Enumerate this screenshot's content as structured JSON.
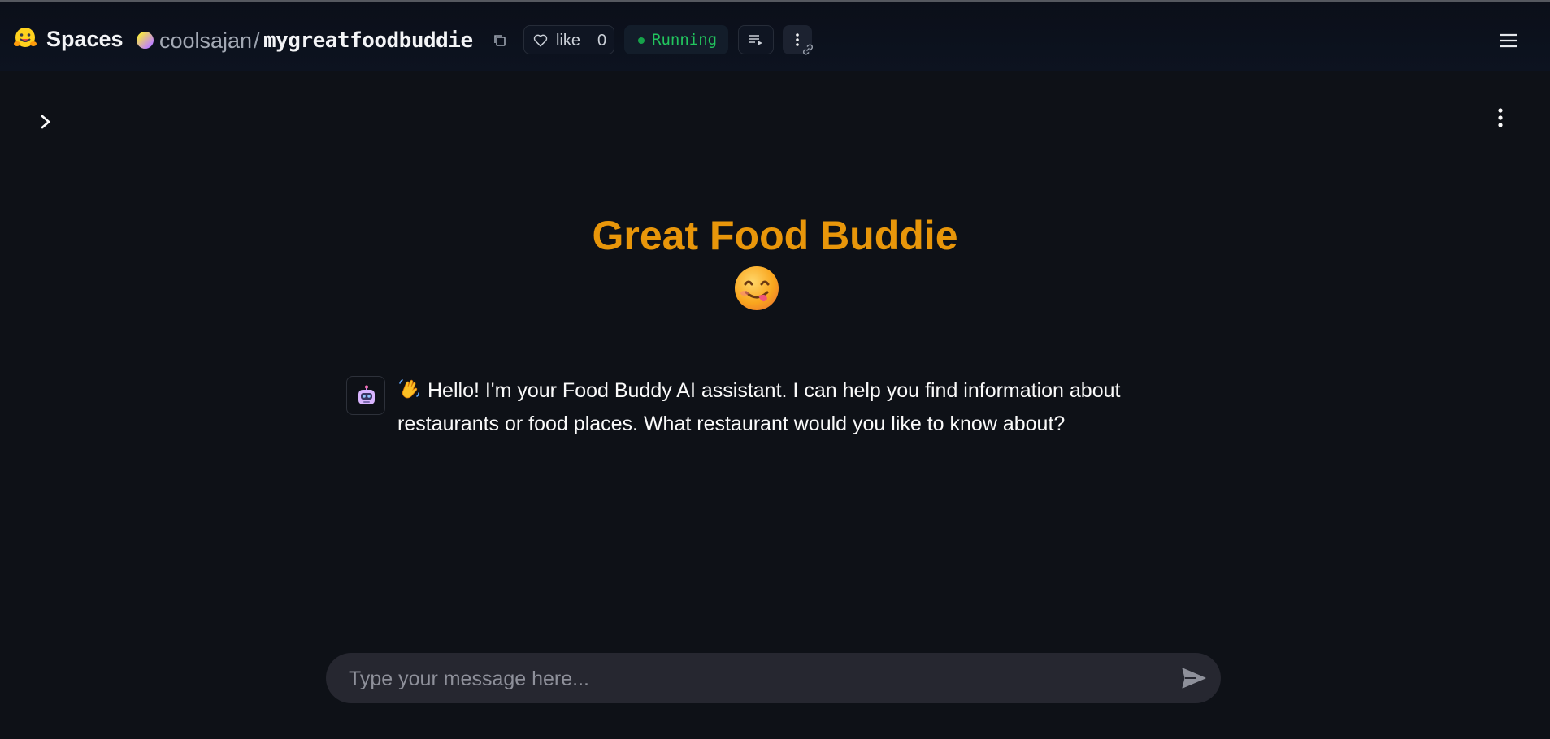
{
  "header": {
    "spaces_label": "Spaces",
    "owner": "coolsajan",
    "separator": "/",
    "repo": "mygreatfoodbuddie",
    "like_label": "like",
    "like_count": "0",
    "status": "Running",
    "status_color": "#22c55e"
  },
  "app": {
    "title": "Great Food Buddie",
    "title_color": "#e8960a",
    "title_emoji": "face-savoring-food",
    "messages": [
      {
        "role": "assistant",
        "avatar": "robot-icon",
        "prefix_emoji": "waving-hand",
        "text": "Hello! I'm your Food Buddy AI assistant. I can help you find information about restaurants or food places. What restaurant would you like to know about?"
      }
    ],
    "input": {
      "placeholder": "Type your message here...",
      "value": ""
    }
  },
  "icons": {
    "logo": "hugging-face-logo",
    "copy": "copy-icon",
    "like": "heart-icon",
    "logs": "logs-icon",
    "more": "kebab-menu-icon",
    "link": "link-icon",
    "menu": "hamburger-menu-icon",
    "sidebar": "chevron-right-icon",
    "send": "send-icon"
  }
}
